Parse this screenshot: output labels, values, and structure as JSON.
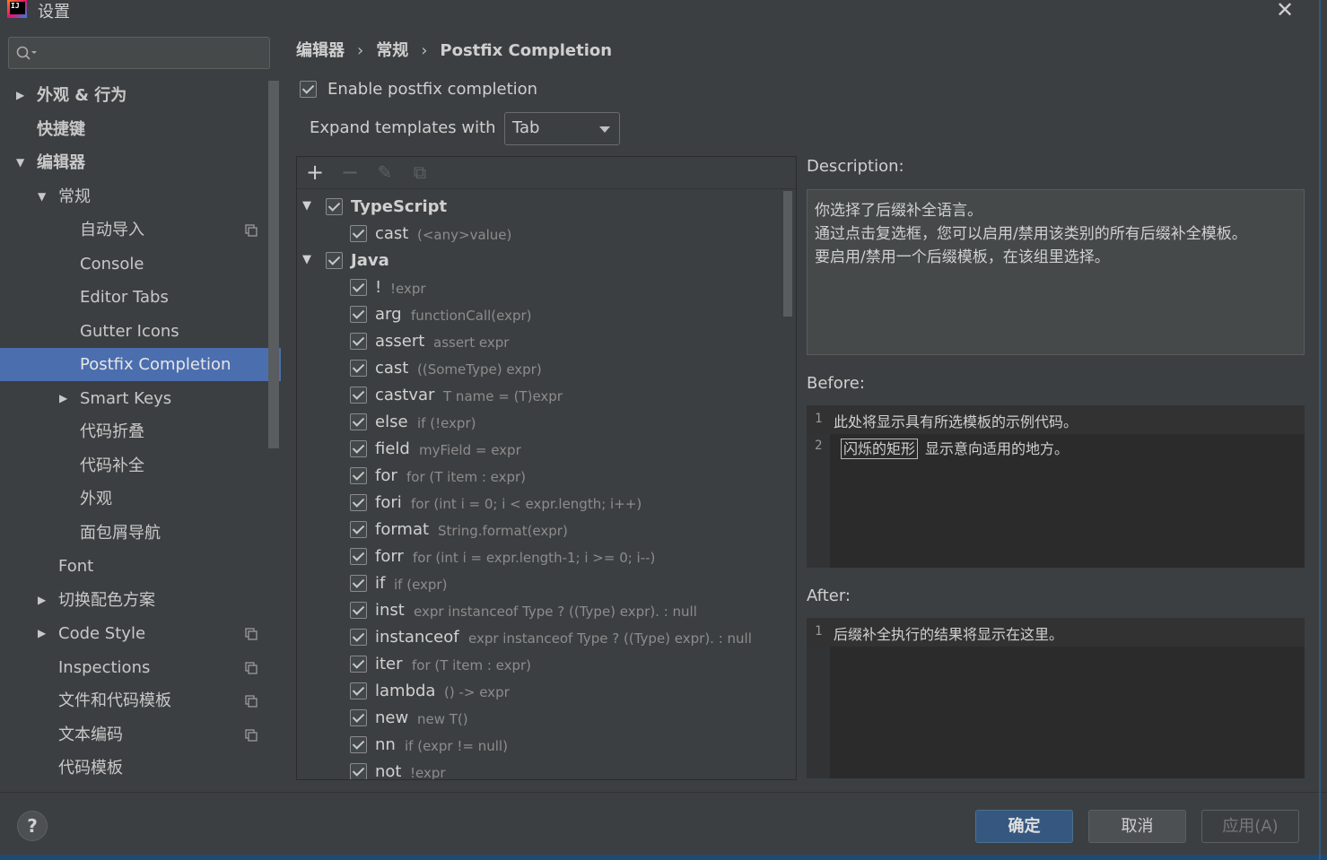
{
  "window": {
    "title": "设置",
    "close_label": "✕"
  },
  "search": {
    "placeholder": ""
  },
  "sidebar": {
    "items": [
      {
        "label": "外观 & 行为",
        "level": 0,
        "arrow": "▶",
        "bold": true
      },
      {
        "label": "快捷键",
        "level": 0,
        "arrow": "",
        "bold": true
      },
      {
        "label": "编辑器",
        "level": 0,
        "arrow": "▼",
        "bold": true
      },
      {
        "label": "常规",
        "level": 1,
        "arrow": "▼",
        "bold": false
      },
      {
        "label": "自动导入",
        "level": 2,
        "arrow": "",
        "bold": false,
        "copy": true
      },
      {
        "label": "Console",
        "level": 2,
        "arrow": "",
        "bold": false
      },
      {
        "label": "Editor Tabs",
        "level": 2,
        "arrow": "",
        "bold": false
      },
      {
        "label": "Gutter Icons",
        "level": 2,
        "arrow": "",
        "bold": false
      },
      {
        "label": "Postfix Completion",
        "level": 2,
        "arrow": "",
        "bold": false,
        "selected": true
      },
      {
        "label": "Smart Keys",
        "level": 2,
        "arrow": "▶",
        "bold": false
      },
      {
        "label": "代码折叠",
        "level": 2,
        "arrow": "",
        "bold": false
      },
      {
        "label": "代码补全",
        "level": 2,
        "arrow": "",
        "bold": false
      },
      {
        "label": "外观",
        "level": 2,
        "arrow": "",
        "bold": false
      },
      {
        "label": "面包屑导航",
        "level": 2,
        "arrow": "",
        "bold": false
      },
      {
        "label": "Font",
        "level": 1,
        "arrow": "",
        "bold": false
      },
      {
        "label": "切换配色方案",
        "level": 1,
        "arrow": "▶",
        "bold": false
      },
      {
        "label": "Code Style",
        "level": 1,
        "arrow": "▶",
        "bold": false,
        "copy": true
      },
      {
        "label": "Inspections",
        "level": 1,
        "arrow": "",
        "bold": false,
        "copy": true
      },
      {
        "label": "文件和代码模板",
        "level": 1,
        "arrow": "",
        "bold": false,
        "copy": true
      },
      {
        "label": "文本编码",
        "level": 1,
        "arrow": "",
        "bold": false,
        "copy": true
      },
      {
        "label": "代码模板",
        "level": 1,
        "arrow": "",
        "bold": false
      }
    ]
  },
  "breadcrumb": {
    "items": [
      "编辑器",
      "常规",
      "Postfix Completion"
    ],
    "separator": "›"
  },
  "settings": {
    "enable_label": "Enable postfix completion",
    "enable_checked": true,
    "expand_label": "Expand templates with",
    "expand_value": "Tab"
  },
  "toolbar": {
    "add": "+",
    "remove": "−",
    "edit": "✎",
    "copy": "⧉"
  },
  "templates": [
    {
      "key": "TypeScript",
      "example": "",
      "group": true
    },
    {
      "key": "cast",
      "example": "(<any>value)",
      "group": false
    },
    {
      "key": "Java",
      "example": "",
      "group": true
    },
    {
      "key": "!",
      "example": "!expr",
      "group": false
    },
    {
      "key": "arg",
      "example": "functionCall(expr)",
      "group": false
    },
    {
      "key": "assert",
      "example": "assert expr",
      "group": false
    },
    {
      "key": "cast",
      "example": "((SomeType) expr)",
      "group": false
    },
    {
      "key": "castvar",
      "example": "T name = (T)expr",
      "group": false
    },
    {
      "key": "else",
      "example": "if (!expr)",
      "group": false
    },
    {
      "key": "field",
      "example": "myField = expr",
      "group": false
    },
    {
      "key": "for",
      "example": "for (T item : expr)",
      "group": false
    },
    {
      "key": "fori",
      "example": "for (int i = 0; i < expr.length; i++)",
      "group": false
    },
    {
      "key": "format",
      "example": "String.format(expr)",
      "group": false
    },
    {
      "key": "forr",
      "example": "for (int i = expr.length-1; i >= 0; i--)",
      "group": false
    },
    {
      "key": "if",
      "example": "if (expr)",
      "group": false
    },
    {
      "key": "inst",
      "example": "expr instanceof Type ? ((Type) expr). : null",
      "group": false
    },
    {
      "key": "instanceof",
      "example": "expr instanceof Type ? ((Type) expr). : null",
      "group": false
    },
    {
      "key": "iter",
      "example": "for (T item : expr)",
      "group": false
    },
    {
      "key": "lambda",
      "example": "() -> expr",
      "group": false
    },
    {
      "key": "new",
      "example": "new T()",
      "group": false
    },
    {
      "key": "nn",
      "example": "if (expr != null)",
      "group": false
    },
    {
      "key": "not",
      "example": "!expr",
      "group": false
    }
  ],
  "description": {
    "label": "Description:",
    "lines": [
      "你选择了后缀补全语言。",
      "通过点击复选框，您可以启用/禁用该类别的所有后缀补全模板。",
      "要启用/禁用一个后缀模板，在该组里选择。"
    ]
  },
  "before": {
    "label": "Before:",
    "line1_num": "1",
    "line1": "此处将显示具有所选模板的示例代码。",
    "line2_num": "2",
    "line2_boxed": "闪烁的矩形",
    "line2_rest": "显示意向适用的地方。"
  },
  "after": {
    "label": "After:",
    "line1_num": "1",
    "line1": "后缀补全执行的结果将显示在这里。"
  },
  "buttons": {
    "help": "?",
    "ok": "确定",
    "cancel": "取消",
    "apply": "应用(A)"
  }
}
